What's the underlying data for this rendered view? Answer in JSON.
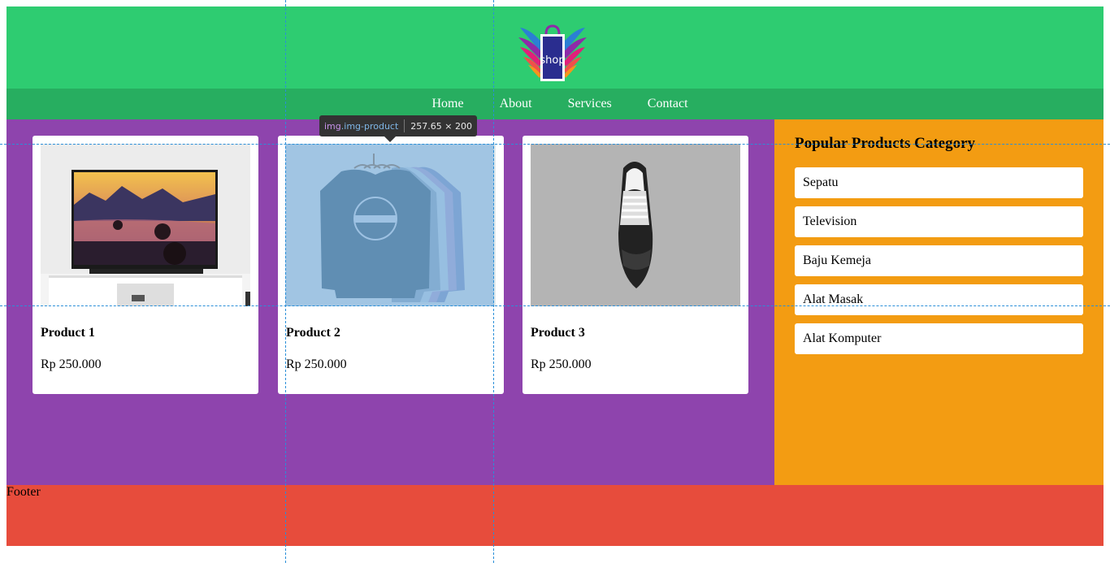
{
  "header": {
    "logo_text": "shop"
  },
  "nav": {
    "items": [
      "Home",
      "About",
      "Services",
      "Contact"
    ]
  },
  "products": [
    {
      "title": "Product 1",
      "price": "Rp 250.000",
      "image": "television-icon"
    },
    {
      "title": "Product 2",
      "price": "Rp 250.000",
      "image": "sweater-icon"
    },
    {
      "title": "Product 3",
      "price": "Rp 250.000",
      "image": "sneaker-icon"
    }
  ],
  "sidebar": {
    "title": "Popular Products Category",
    "categories": [
      "Sepatu",
      "Television",
      "Baju Kemeja",
      "Alat Masak",
      "Alat Komputer"
    ]
  },
  "footer": {
    "text": "Footer"
  },
  "devtools": {
    "tag": "img",
    "class": ".img-product",
    "dimensions": "257.65 × 200"
  },
  "colors": {
    "header": "#2ecc71",
    "nav": "#27ae60",
    "main": "#8e44ad",
    "aside": "#f39c12",
    "footer": "#e74c3c"
  }
}
